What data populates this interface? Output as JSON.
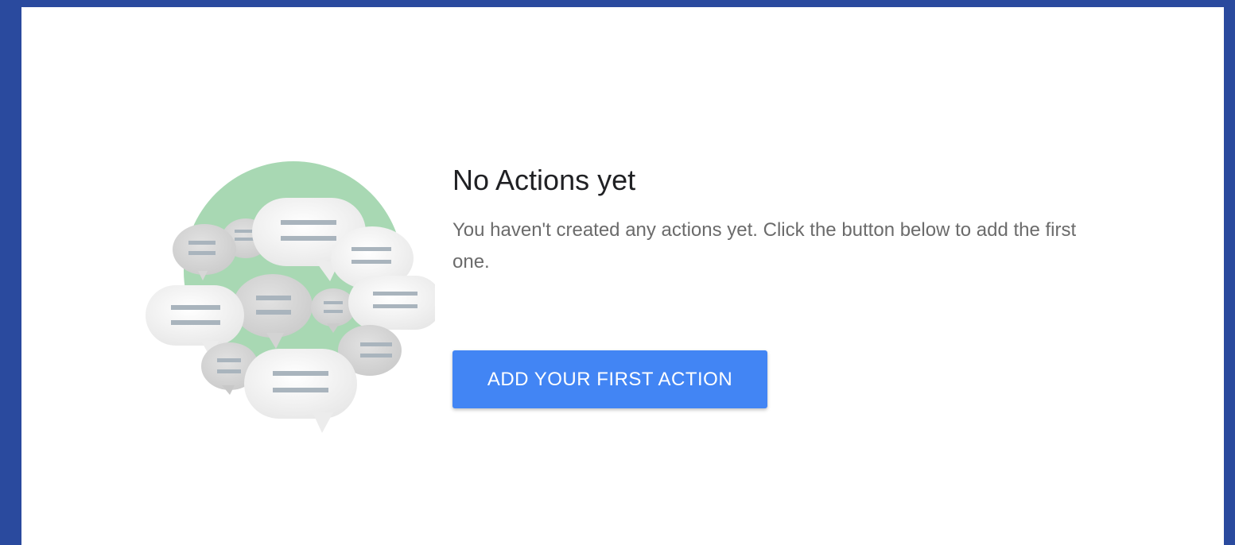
{
  "empty_state": {
    "title": "No Actions yet",
    "description": "You haven't created any actions yet. Click the button below to add the first one.",
    "button_label": "ADD YOUR FIRST ACTION"
  },
  "colors": {
    "frame_background": "#2a4a9e",
    "button_background": "#4285f4",
    "illustration_circle": "#a8d8b3"
  },
  "icons": {
    "illustration": "chat-bubbles-illustration"
  }
}
